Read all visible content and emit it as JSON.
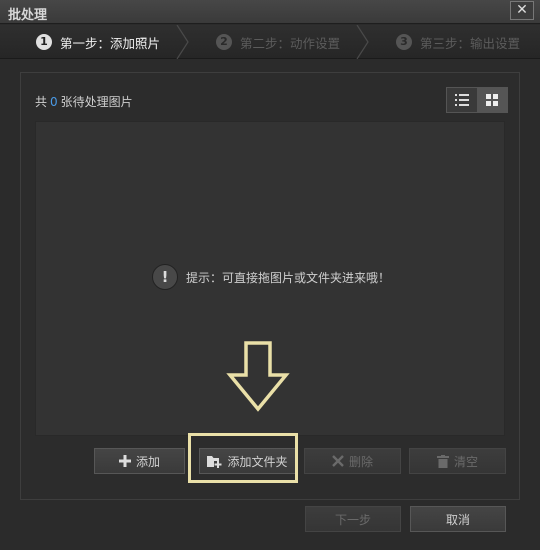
{
  "window": {
    "title": "批处理",
    "close_glyph": "✕"
  },
  "steps": [
    {
      "num": "1",
      "label": "第一步：添加照片",
      "active": true
    },
    {
      "num": "2",
      "label": "第二步：动作设置",
      "active": false
    },
    {
      "num": "3",
      "label": "第三步：输出设置",
      "active": false
    }
  ],
  "status": {
    "prefix": "共",
    "count": "0",
    "suffix": "张待处理图片"
  },
  "view_modes": [
    {
      "icon": "list-view-icon",
      "selected": false
    },
    {
      "icon": "grid-view-icon",
      "selected": true
    }
  ],
  "hint": {
    "icon": "exclamation-icon",
    "glyph": "!",
    "text": "提示：可直接拖图片或文件夹进来哦！"
  },
  "actions": {
    "add": {
      "label": "添加",
      "icon": "plus-icon",
      "enabled": true
    },
    "add_folder": {
      "label": "添加文件夹",
      "icon": "folder-add-icon",
      "enabled": true
    },
    "delete": {
      "label": "删除",
      "icon": "x-icon",
      "enabled": false
    },
    "clear": {
      "label": "清空",
      "icon": "trash-icon",
      "enabled": false
    }
  },
  "footer": {
    "next": {
      "label": "下一步",
      "enabled": false
    },
    "cancel": {
      "label": "取消",
      "enabled": true
    }
  },
  "colors": {
    "count_accent": "#4a9be8",
    "highlight": "#eae0a8"
  }
}
